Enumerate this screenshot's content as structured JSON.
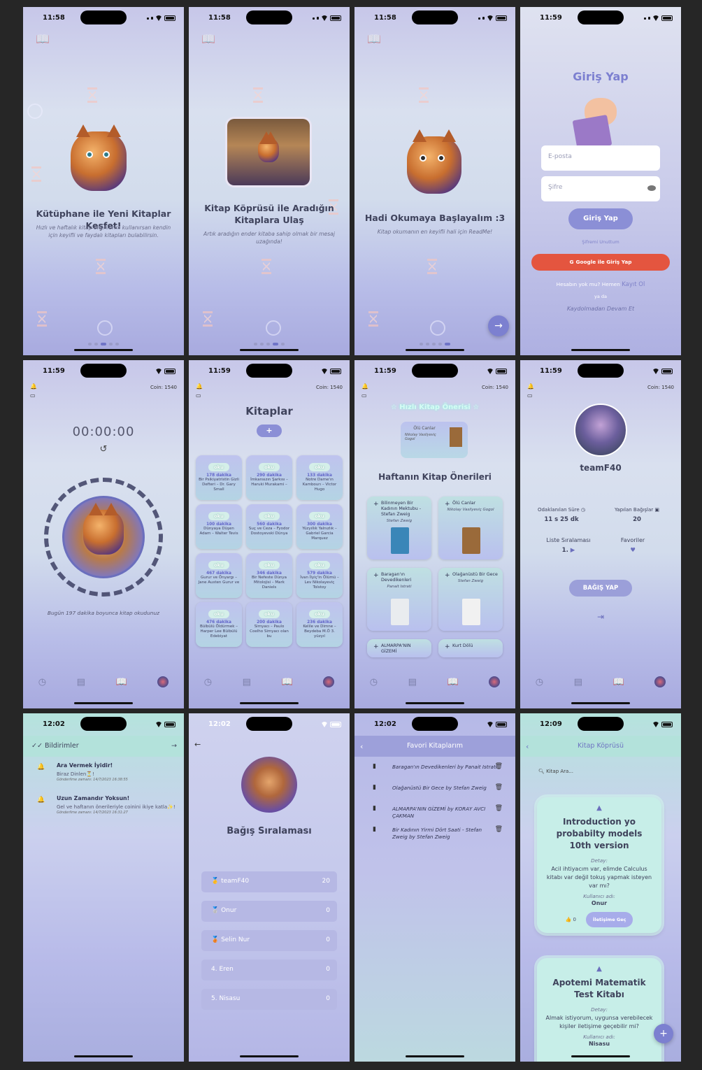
{
  "status": {
    "time_1158": "11:58",
    "time_1159": "11:59",
    "time_1202": "12:02",
    "time_1209": "12:09"
  },
  "onboarding": [
    {
      "title": "Kütüphane ile Yeni Kitaplar Keşfet!",
      "subtitle": "Hızlı ve haftalık kitap önerilerini kullanırsan kendin için keyifli ve faydalı kitapları bulabilirsin."
    },
    {
      "title": "Kitap Köprüsü ile Aradığın Kitaplara Ulaş",
      "subtitle": "Artık aradığın ender kitaba sahip olmak bir mesaj uzağında!"
    },
    {
      "title": "Hadi Okumaya Başlayalım :3",
      "subtitle": "Kitap okumanın en keyifli hali için ReadMe!"
    }
  ],
  "login": {
    "title": "Giriş Yap",
    "email_placeholder": "E-posta",
    "password_placeholder": "Şifre",
    "login_button": "Giriş Yap",
    "forgot": "Şifremi Unuttum",
    "google": "Google ile Giriş Yap",
    "no_account": "Hesabın yok mu? Hemen",
    "register": "Kayıt Ol",
    "or": "ya da",
    "guest": "Kaydolmadan Devam Et"
  },
  "coin": "Coin: 1540",
  "timer": {
    "value": "00:00:00",
    "caption": "Bugün 197 dakika boyunca kitap okudunuz"
  },
  "books": {
    "title": "Kitaplar",
    "add": "+",
    "oku": "oku",
    "items": [
      {
        "mins": "178 dakika",
        "name": "Bir Psikiyatristin Gizli Defteri – Dr. Gary Small"
      },
      {
        "mins": "290 dakika",
        "name": "İmkansızın Şarkısı – Haruki Murakami –"
      },
      {
        "mins": "133 dakika",
        "name": "Notre Dame'ın Kambourı – Victor Hugo"
      },
      {
        "mins": "100 dakika",
        "name": "Dünyaya Düşen Adam – Walter Tevis"
      },
      {
        "mins": "560 dakika",
        "name": "Suç ve Ceza – Fyodor Dostoyevski Dünya"
      },
      {
        "mins": "300 dakika",
        "name": "Yüzyıllık Yalnızlık – Gabriel Garcia Marquez"
      },
      {
        "mins": "467 dakika",
        "name": "Gurur ve Önyargı – Jane Austen Gurur ve"
      },
      {
        "mins": "346 dakika",
        "name": "Bir Nefeste Dünya Mitolojisi – Mark Daniels"
      },
      {
        "mins": "579 dakika",
        "name": "İvan İlyiç'in Ölümü – Lev Nikolayeviç Tolstoy"
      },
      {
        "mins": "476 dakika",
        "name": "Bülbülü Öldürmek – Harper Lee Bülbülü Edebiyat"
      },
      {
        "mins": "200 dakika",
        "name": "Simyacı – Paulo Coelho Simyacı olan bu"
      },
      {
        "mins": "236 dakika",
        "name": "Kelile ve Dimne – Beydeba M.Ö 3. yüzyıl"
      }
    ]
  },
  "suggest": {
    "quick_title": "Hızlı Kitap Önerisi",
    "quick_book": "Ölü Canlar",
    "quick_author": "Nikolay Vasilyeviç Gogol",
    "weekly_title": "Haftanın Kitap Önerileri",
    "weekly": [
      {
        "title": "Bilinmeyen Bir Kadının Mektubu - Stefan Zweig",
        "author": "Stefan Zweig"
      },
      {
        "title": "Ölü Canlar",
        "author": "Nikolay Vasilyeviç Gogol"
      },
      {
        "title": "Baragan'ın Devedikenleri",
        "author": "Panait Istrati"
      },
      {
        "title": "Olağanüstü Bir Gece",
        "author": "Stefan Zweig"
      },
      {
        "title": "ALMARPA'NIN GİZEMİ",
        "author": ""
      },
      {
        "title": "Kurt Dölü",
        "author": ""
      }
    ]
  },
  "profile": {
    "name": "teamF40",
    "focus_label": "Odaklanılan Süre",
    "focus_value": "11 s 25 dk",
    "donations_label": "Yapılan Bağışlar",
    "donations_value": "20",
    "rank_label": "Liste Sıralaması",
    "rank_value": "1.",
    "fav_label": "Favoriler",
    "donate_button": "BAĞIŞ YAP"
  },
  "notifications": {
    "title": "Bildirimler",
    "items": [
      {
        "title": "Ara Vermek İyidir!",
        "body": "Biraz Dinlen⏳!",
        "date": "Gönderilme zamanı: 14/7/2023 16:38:55"
      },
      {
        "title": "Uzun Zamandır Yoksun!",
        "body": "Gel ve haftanın önerileriyle coinini ikiye katla✨!",
        "date": "Gönderilme zamanı: 14/7/2023 16:31:27"
      }
    ]
  },
  "ranking": {
    "title": "Bağış Sıralaması",
    "rows": [
      {
        "name": "teamF40",
        "value": "20",
        "medal": "🥇"
      },
      {
        "name": "Onur",
        "value": "0",
        "medal": "🥈"
      },
      {
        "name": "Selin Nur",
        "value": "0",
        "medal": "🥉"
      },
      {
        "name": "4. Eren",
        "value": "0",
        "medal": ""
      },
      {
        "name": "5. Nisasu",
        "value": "0",
        "medal": ""
      }
    ]
  },
  "favorites": {
    "title": "Favori Kitaplarım",
    "items": [
      "Baragan'ın Devedikenleri by Panait Istrati",
      "Olağanüstü Bir Gece by Stefan Zweig",
      "ALMARPA'NIN GİZEMİ by KORAY AVCI ÇAKMAN",
      "Bir Kadının Yirmi Dört Saati - Stefan Zweig by Stefan Zweig"
    ]
  },
  "bridge": {
    "title": "Kitap Köprüsü",
    "search": "Kitap Ara...",
    "detail_label": "Detay:",
    "user_label": "Kullanıcı adı:",
    "contact": "İletişime Geç",
    "posts": [
      {
        "title": "Introduction yo probabilty models 10th version",
        "detail": "Acil ihtiyacım var, elimde Calculus kitabı var değil tokuş yapmak isteyen var mı?",
        "user": "Onur",
        "likes": "0"
      },
      {
        "title": "Apotemi Matematik Test Kitabı",
        "detail": "Almak istiyorum, uygunsa verebilecek kişiler iletişime geçebilir mi?",
        "user": "Nisasu"
      }
    ]
  },
  "colors": {
    "accent": "#8b8fd6",
    "google": "#e4553f",
    "dark": "#262626"
  }
}
